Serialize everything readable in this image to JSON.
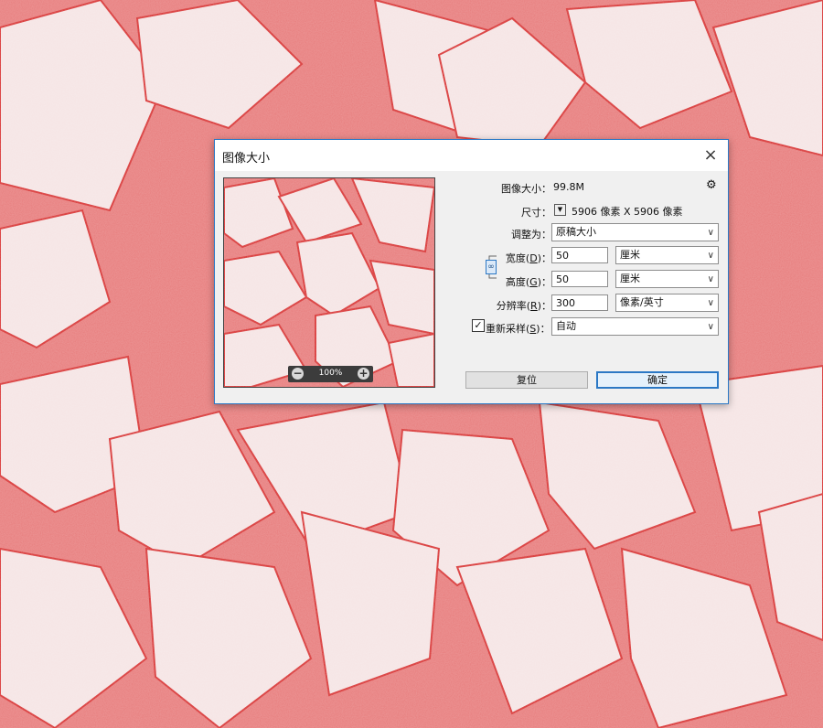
{
  "dialog": {
    "title": "图像大小",
    "close_icon": "×"
  },
  "preview": {
    "zoom": "100%",
    "zoom_out_icon": "−",
    "zoom_in_icon": "+"
  },
  "info": {
    "image_size_label": "图像大小：",
    "image_size_value": "99.8M",
    "dimensions_label": "尺寸：",
    "dimensions_value": "5906 像素  X  5906 像素",
    "gear_icon": "⚙"
  },
  "fit_to": {
    "label": "调整为：",
    "value": "原稿大小"
  },
  "width": {
    "label_pre": "宽度(",
    "label_key": "D",
    "label_post": ")：",
    "value": "50",
    "unit": "厘米"
  },
  "height": {
    "label_pre": "高度(",
    "label_key": "G",
    "label_post": ")：",
    "value": "50",
    "unit": "厘米"
  },
  "resolution": {
    "label_pre": "分辨率(",
    "label_key": "R",
    "label_post": ")：",
    "value": "300",
    "unit": "像素/英寸"
  },
  "resample": {
    "checked": true,
    "check_glyph": "✓",
    "label_pre": "重新采样(",
    "label_key": "S",
    "label_post": ")：",
    "value": "自动"
  },
  "buttons": {
    "reset": "复位",
    "ok": "确定"
  },
  "colors": {
    "accent": "#2b78c5",
    "background_red": "#e77c7c",
    "patch_white": "#f7eaea"
  }
}
